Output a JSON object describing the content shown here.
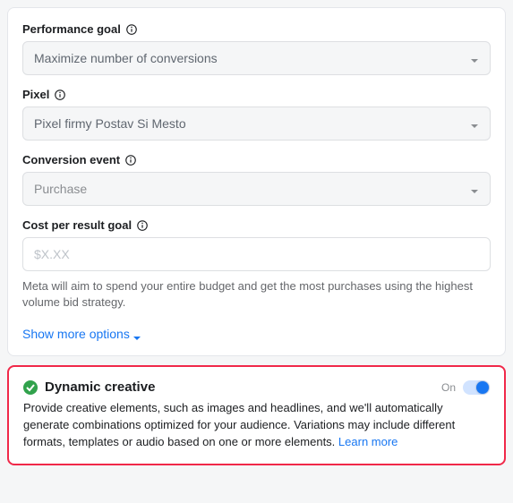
{
  "performance": {
    "label": "Performance goal",
    "value": "Maximize number of conversions"
  },
  "pixel": {
    "label": "Pixel",
    "value": "Pixel firmy Postav Si Mesto"
  },
  "conversion_event": {
    "label": "Conversion event",
    "value": "Purchase"
  },
  "cost_goal": {
    "label": "Cost per result goal",
    "placeholder": "$X.XX",
    "helper": "Meta will aim to spend your entire budget and get the most purchases using the highest volume bid strategy."
  },
  "show_more": "Show more options",
  "dynamic_creative": {
    "title": "Dynamic creative",
    "state_label": "On",
    "description": "Provide creative elements, such as images and headlines, and we'll automatically generate combinations optimized for your audience. Variations may include different formats, templates or audio based on one or more elements. ",
    "learn_more": "Learn more"
  }
}
